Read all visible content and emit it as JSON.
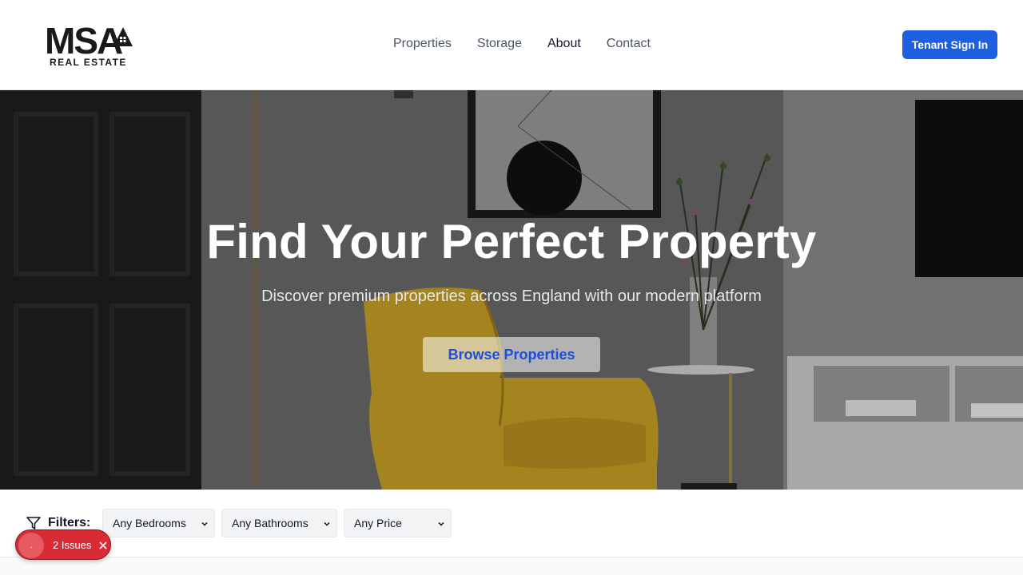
{
  "brand": {
    "name": "MSA",
    "subtitle": "REAL ESTATE"
  },
  "nav": {
    "items": [
      "Properties",
      "Storage",
      "About",
      "Contact"
    ],
    "active": "About"
  },
  "header": {
    "signin_label": "Tenant Sign In"
  },
  "hero": {
    "title": "Find Your Perfect Property",
    "subtitle": "Discover premium properties across England with our modern platform",
    "cta_label": "Browse Properties"
  },
  "filters": {
    "label": "Filters:",
    "bedrooms": "Any Bedrooms",
    "bathrooms": "Any Bathrooms",
    "price": "Any Price"
  },
  "issues": {
    "dot": ".",
    "count": "2 Issues"
  },
  "colors": {
    "primary": "#1d5fe0",
    "issues_badge": "#d92b35",
    "chair": "#c9a227"
  }
}
